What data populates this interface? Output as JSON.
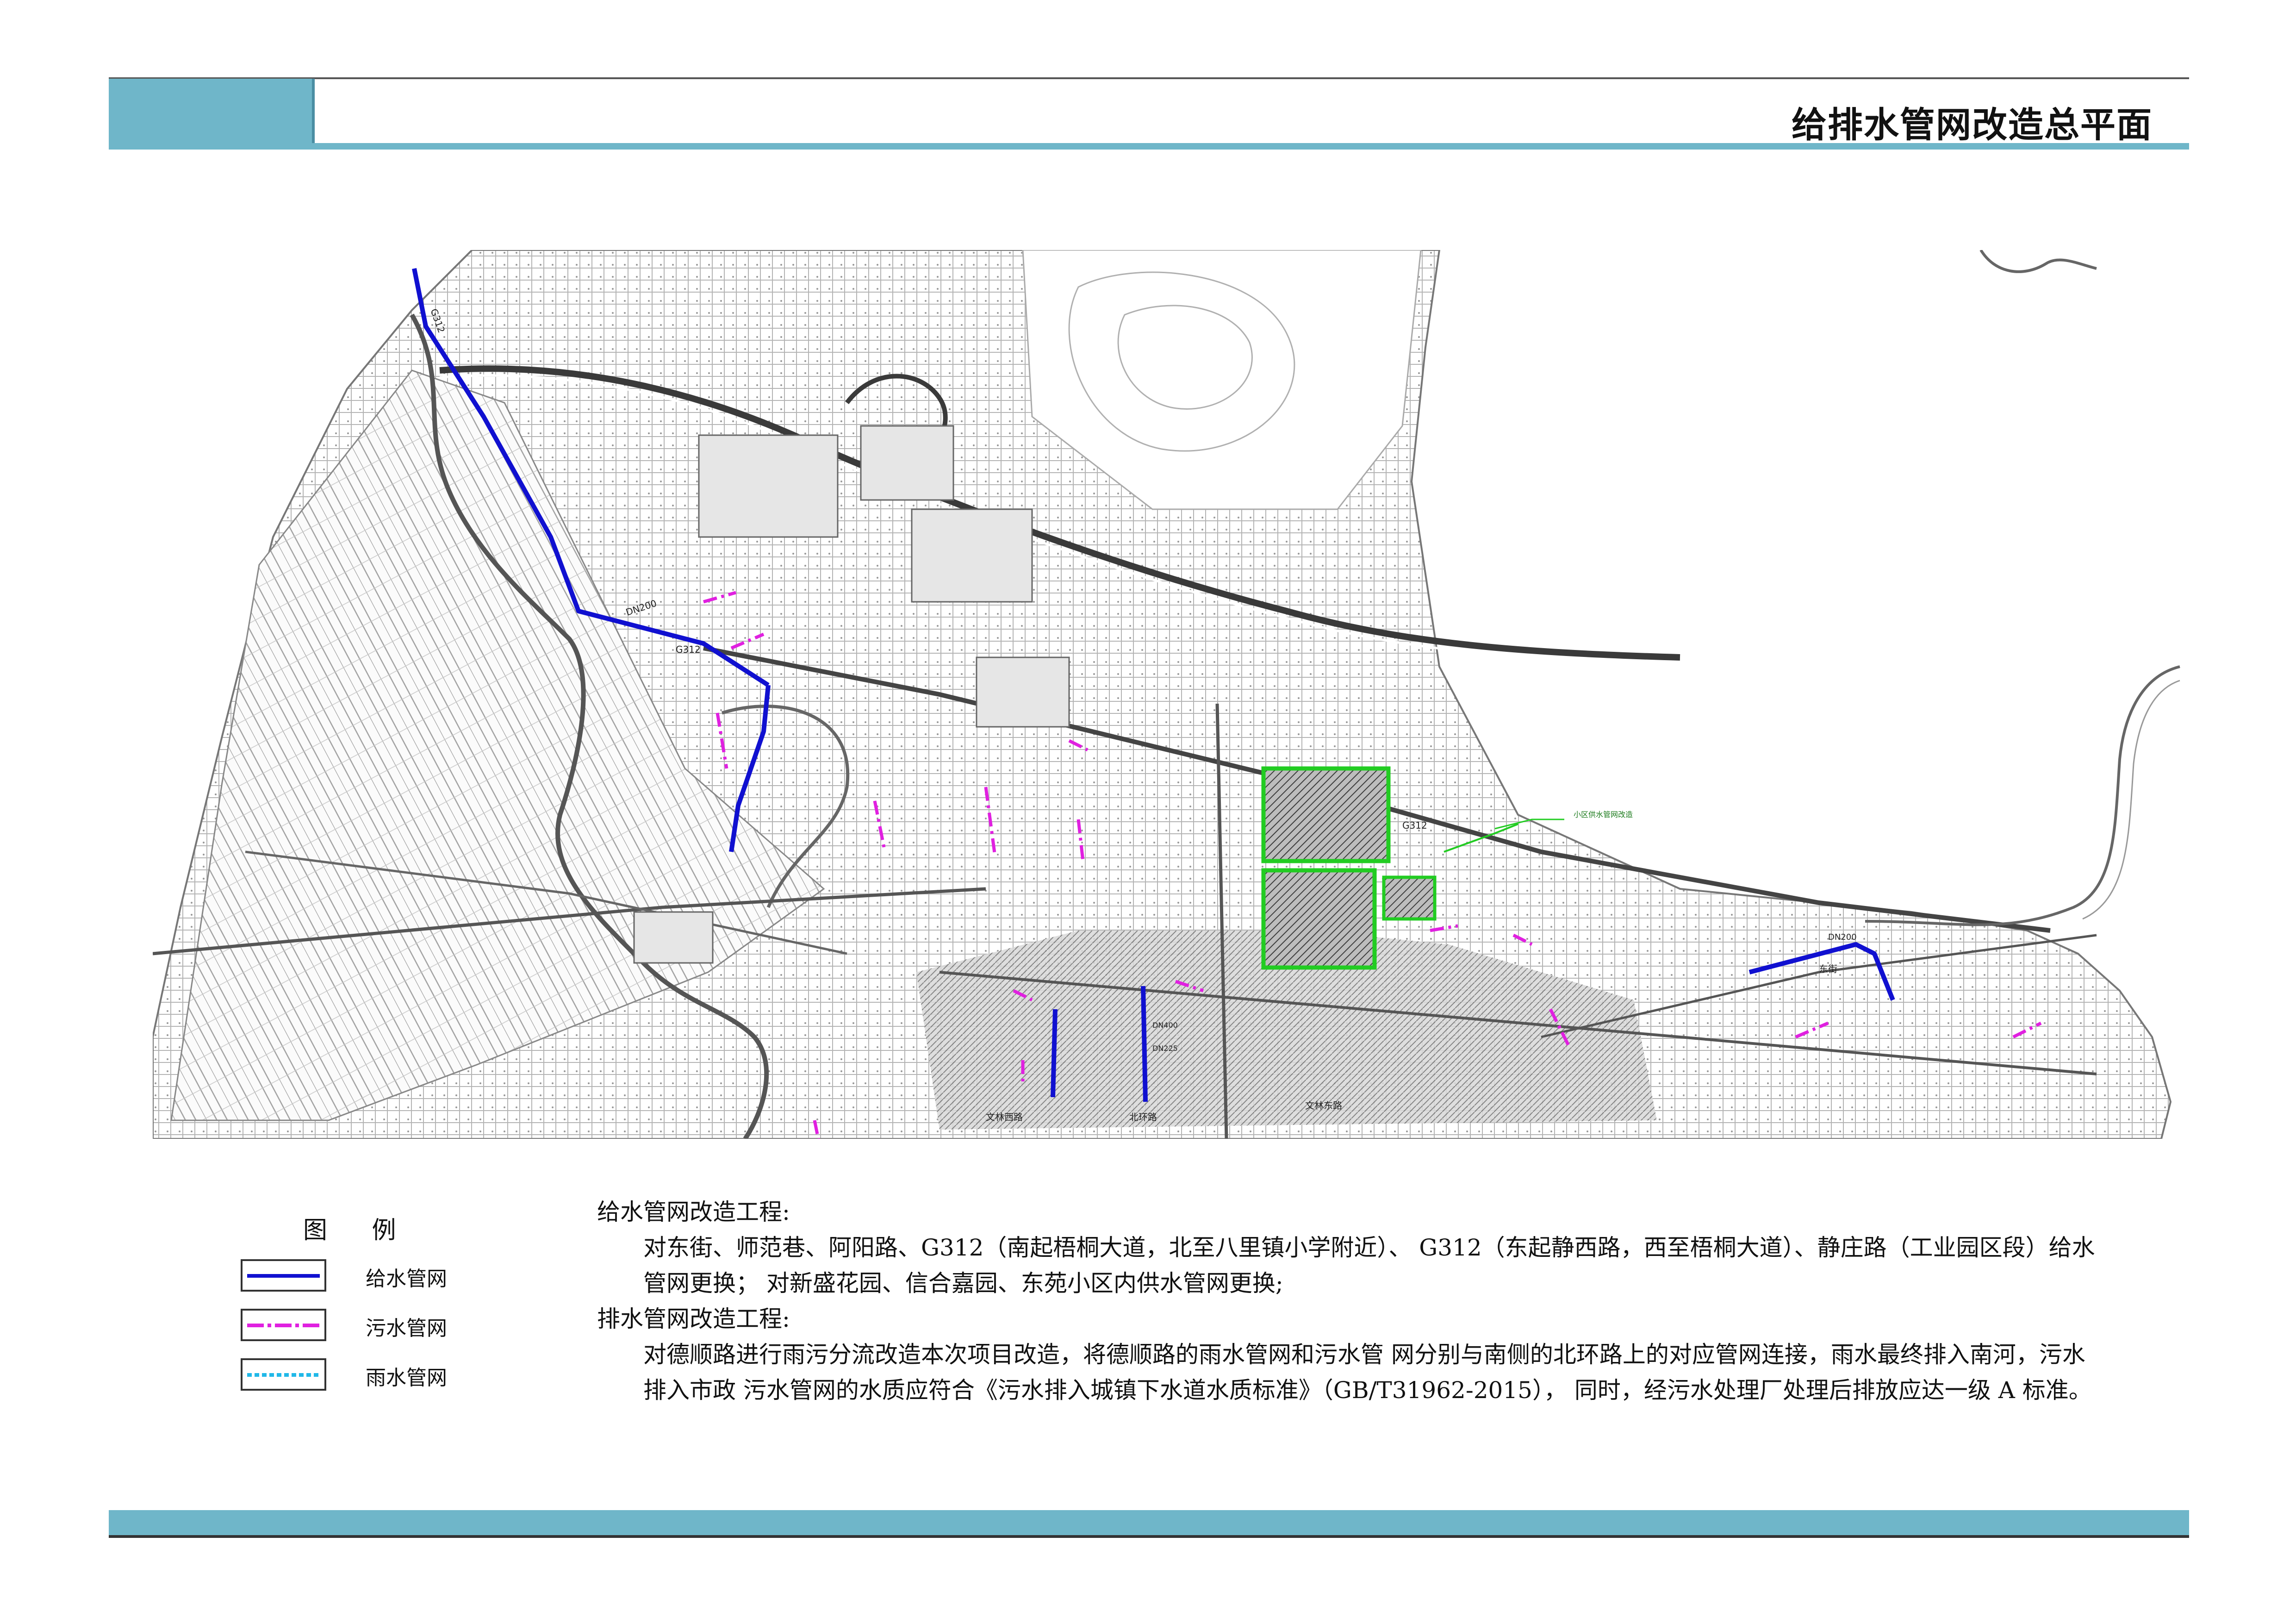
{
  "header": {
    "title": "给排水管网改造总平面"
  },
  "legend": {
    "title": "图 例",
    "items": [
      {
        "label": "给水管网",
        "color": "#1010d0",
        "style": "solid"
      },
      {
        "label": "污水管网",
        "color": "#e020e0",
        "style": "dash-dot"
      },
      {
        "label": "雨水管网",
        "color": "#20b8e8",
        "style": "dotted"
      }
    ]
  },
  "description": {
    "water_heading": "给水管网改造工程:",
    "water_body": "对东街、师范巷、阿阳路、G312（南起梧桐大道，北至八里镇小学附近）、 G312（东起静西路，西至梧桐大道）、静庄路（工业园区段）给水管网更换； 对新盛花园、信合嘉园、东苑小区内供水管网更换;",
    "drain_heading": "排水管网改造工程:",
    "drain_body": "对德顺路进行雨污分流改造本次项目改造，将德顺路的雨水管网和污水管 网分别与南侧的北环路上的对应管网连接，雨水最终排入南河，污水排入市政 污水管网的水质应符合《污水排入城镇下水道水质标准》（GB/T31962-2015）， 同时，经污水处理厂处理后排放应达一级 A 标准。"
  },
  "map": {
    "colors": {
      "water_supply": "#1010d0",
      "sewage": "#e020e0",
      "rain": "#20b8e8",
      "residential": "#22cc22",
      "base": "#8a8a8a"
    },
    "labels": {
      "g312_a": "G312",
      "g312_b": "G312",
      "g312_c": "G312",
      "dn200_a": "DN200",
      "dn200_b": "DN200",
      "dn400": "DN400",
      "dn225": "DN225",
      "east_street": "东街",
      "wenlin_west": "文林西路",
      "wenlin_east": "文林东路",
      "beihuan": "北环路",
      "water_supply_note": "小区供水管网改造"
    }
  }
}
